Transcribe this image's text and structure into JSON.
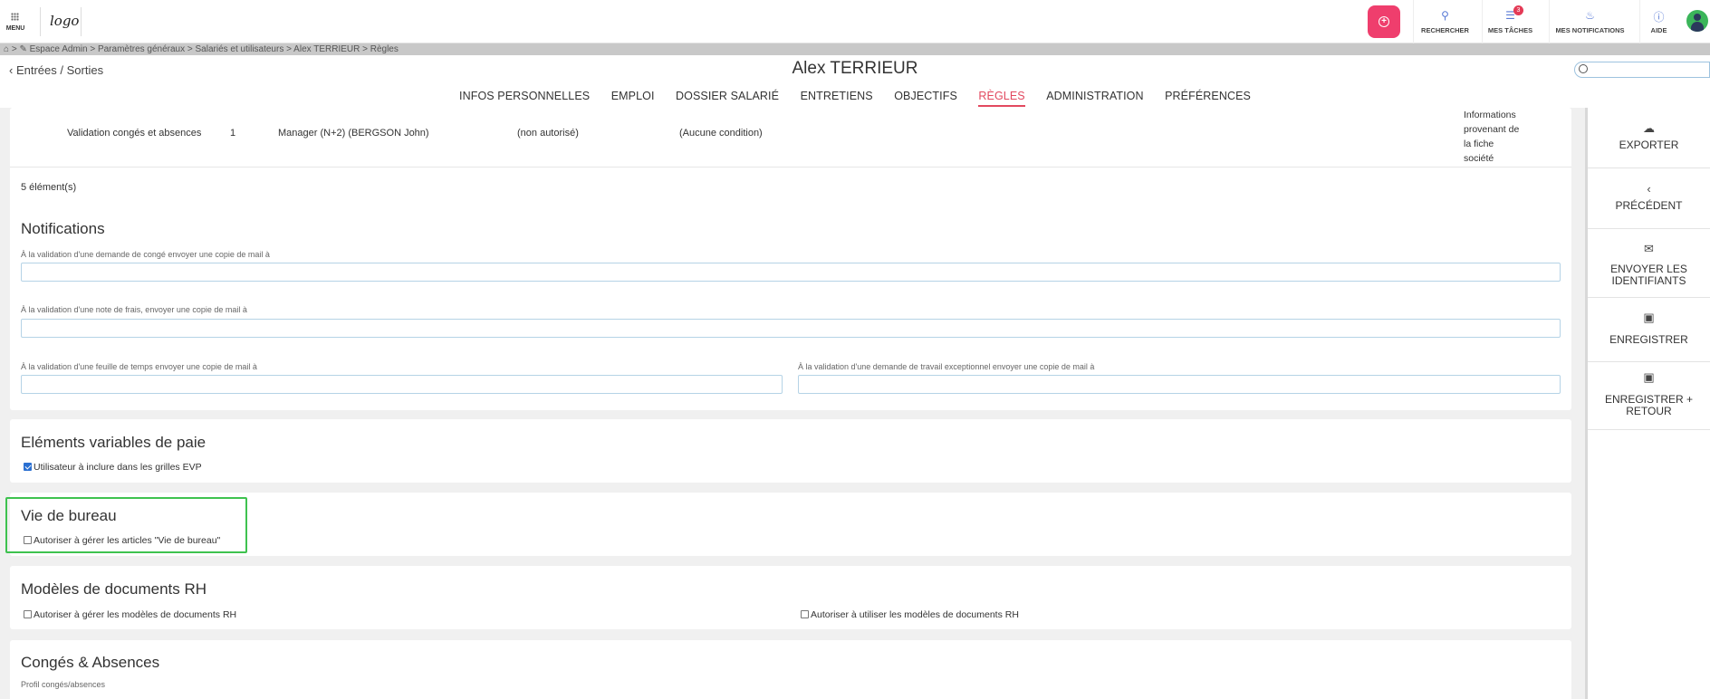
{
  "topbar": {
    "menu_label": "MENU",
    "logo_text": "logo",
    "items": [
      {
        "label": "RECHERCHER",
        "icon": "search-icon"
      },
      {
        "label": "MES TÂCHES",
        "icon": "tasks-icon",
        "badge": "3"
      },
      {
        "label": "MES NOTIFICATIONS",
        "icon": "bell-icon"
      },
      {
        "label": "AIDE",
        "icon": "help-icon"
      }
    ],
    "accent": "#ef3e6d"
  },
  "breadcrumb": "Espace Admin > Paramètres généraux > Salariés et utilisateurs > Alex TERRIEUR > Règles",
  "header": {
    "back_label": "Entrées / Sorties",
    "title": "Alex TERRIEUR",
    "search_value": ""
  },
  "tabs": [
    {
      "label": "INFOS PERSONNELLES",
      "active": false
    },
    {
      "label": "EMPLOI",
      "active": false
    },
    {
      "label": "DOSSIER SALARIÉ",
      "active": false
    },
    {
      "label": "ENTRETIENS",
      "active": false
    },
    {
      "label": "OBJECTIFS",
      "active": false
    },
    {
      "label": "RÈGLES",
      "active": true
    },
    {
      "label": "ADMINISTRATION",
      "active": false
    },
    {
      "label": "PRÉFÉRENCES",
      "active": false
    }
  ],
  "rules_row": {
    "name": "Validation congés et absences",
    "level": "1",
    "validator": "Manager (N+2) (BERGSON John)",
    "delegation": "(non autorisé)",
    "condition": "(Aucune condition)",
    "info_lines": [
      "Informations",
      "provenant de",
      "la fiche",
      "société"
    ]
  },
  "count_label": "5 élément(s)",
  "notifications": {
    "title": "Notifications",
    "conge_label": "À la validation d'une demande de congé envoyer une copie de mail à",
    "frais_label": "À la validation d'une note de frais, envoyer une copie de mail à",
    "temps_label": "À la validation d'une feuille de temps envoyer une copie de mail à",
    "travail_label": "À la validation d'une demande de travail exceptionnel envoyer une copie de mail à"
  },
  "evp": {
    "title": "Eléments variables de paie",
    "checkbox_label": "Utilisateur à inclure dans les grilles EVP",
    "checked": true
  },
  "vie_bureau": {
    "title": "Vie de bureau",
    "checkbox_label": "Autoriser à gérer les articles \"Vie de bureau\"",
    "checked": false
  },
  "modeles": {
    "title": "Modèles de documents RH",
    "manage_label": "Autoriser à gérer les modèles de documents RH",
    "use_label": "Autoriser à utiliser les modèles de documents RH"
  },
  "conges": {
    "title": "Congés & Absences",
    "profile_label": "Profil congés/absences"
  },
  "sidepanel": [
    {
      "label": "EXPORTER",
      "icon": "cloud-upload-icon"
    },
    {
      "label": "PRÉCÉDENT",
      "icon": "chevron-left-icon"
    },
    {
      "label": "ENVOYER LES IDENTIFIANTS",
      "icon": "envelope-icon"
    },
    {
      "label": "ENREGISTRER",
      "icon": "save-icon"
    },
    {
      "label": "ENREGISTRER + RETOUR",
      "icon": "save-return-icon"
    }
  ]
}
